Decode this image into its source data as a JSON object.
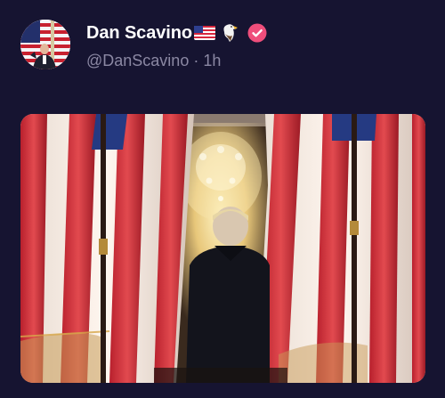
{
  "post": {
    "author_name": "Dan Scavino",
    "handle": "@DanScavino",
    "separator": "·",
    "time_ago": "1h"
  },
  "icons": {
    "flag": "us-flag-emoji-icon",
    "eagle": "eagle-emoji-icon",
    "verified": "verified-badge-icon"
  },
  "colors": {
    "background": "#161431",
    "name_text": "#ffffff",
    "meta_text": "#8b88a3",
    "verified_badge": "#ef4e7b"
  }
}
